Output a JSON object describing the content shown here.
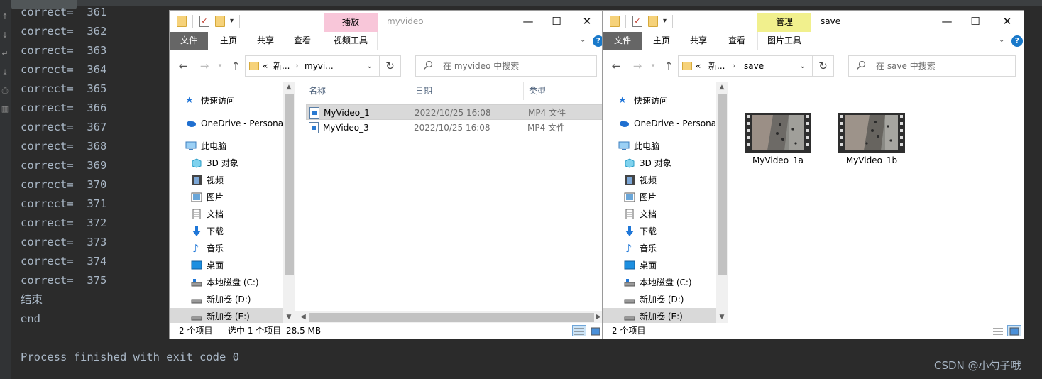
{
  "console": {
    "lines": [
      "correct=  361",
      "correct=  362",
      "correct=  363",
      "correct=  364",
      "correct=  365",
      "correct=  366",
      "correct=  367",
      "correct=  368",
      "correct=  369",
      "correct=  370",
      "correct=  371",
      "correct=  372",
      "correct=  373",
      "correct=  374",
      "correct=  375",
      "结束",
      "end",
      "",
      "Process finished with exit code 0"
    ],
    "text_color": "#a9b7c6",
    "background": "#2b2b2b"
  },
  "watermark": "CSDN @小勺子哦",
  "window1": {
    "context_tab": "播放",
    "context_color": "#f8c6d9",
    "title": "myvideo",
    "ribbon_tabs": [
      "文件",
      "主页",
      "共享",
      "查看",
      "视频工具"
    ],
    "breadcrumb": [
      "«",
      "新...",
      "myvi..."
    ],
    "search_placeholder": "在 myvideo 中搜索",
    "columns": [
      "名称",
      "日期",
      "类型"
    ],
    "files": [
      {
        "name": "MyVideo_1",
        "date": "2022/10/25 16:08",
        "type": "MP4 文件",
        "selected": true
      },
      {
        "name": "MyVideo_3",
        "date": "2022/10/25 16:08",
        "type": "MP4 文件",
        "selected": false
      }
    ],
    "status": {
      "count": "2 个项目",
      "selected": "选中 1 个项目",
      "size": "28.5 MB"
    }
  },
  "window2": {
    "context_tab": "管理",
    "context_color": "#f1f08d",
    "title": "save",
    "ribbon_tabs": [
      "文件",
      "主页",
      "共享",
      "查看",
      "图片工具"
    ],
    "breadcrumb": [
      "«",
      "新...",
      "save"
    ],
    "search_placeholder": "在 save 中搜索",
    "thumbnails": [
      {
        "label": "MyVideo_1a"
      },
      {
        "label": "MyVideo_1b"
      }
    ],
    "status": {
      "count": "2 个项目"
    }
  },
  "nav_items": [
    {
      "label": "快速访问",
      "icon": "star-icon"
    },
    {
      "label": "OneDrive - Persona",
      "icon": "cloud-icon"
    },
    {
      "label": "此电脑",
      "icon": "computer-icon"
    },
    {
      "label": "3D 对象",
      "icon": "cube-icon"
    },
    {
      "label": "视频",
      "icon": "film-icon"
    },
    {
      "label": "图片",
      "icon": "picture-icon"
    },
    {
      "label": "文档",
      "icon": "document-icon"
    },
    {
      "label": "下载",
      "icon": "download-arrow-icon"
    },
    {
      "label": "音乐",
      "icon": "music-note-icon"
    },
    {
      "label": "桌面",
      "icon": "desktop-icon"
    },
    {
      "label": "本地磁盘 (C:)",
      "icon": "drive-c-icon"
    },
    {
      "label": "新加卷 (D:)",
      "icon": "drive-icon"
    },
    {
      "label": "新加卷 (E:)",
      "icon": "drive-icon"
    }
  ],
  "window_controls": {
    "minimize": "—",
    "maximize": "☐",
    "close": "✕"
  },
  "icons": {
    "back": "←",
    "forward": "→",
    "up": "↑",
    "refresh": "↻",
    "dropdown": "⌄",
    "chevron": "›",
    "help": "?",
    "ribbon_collapse": "⌄"
  }
}
